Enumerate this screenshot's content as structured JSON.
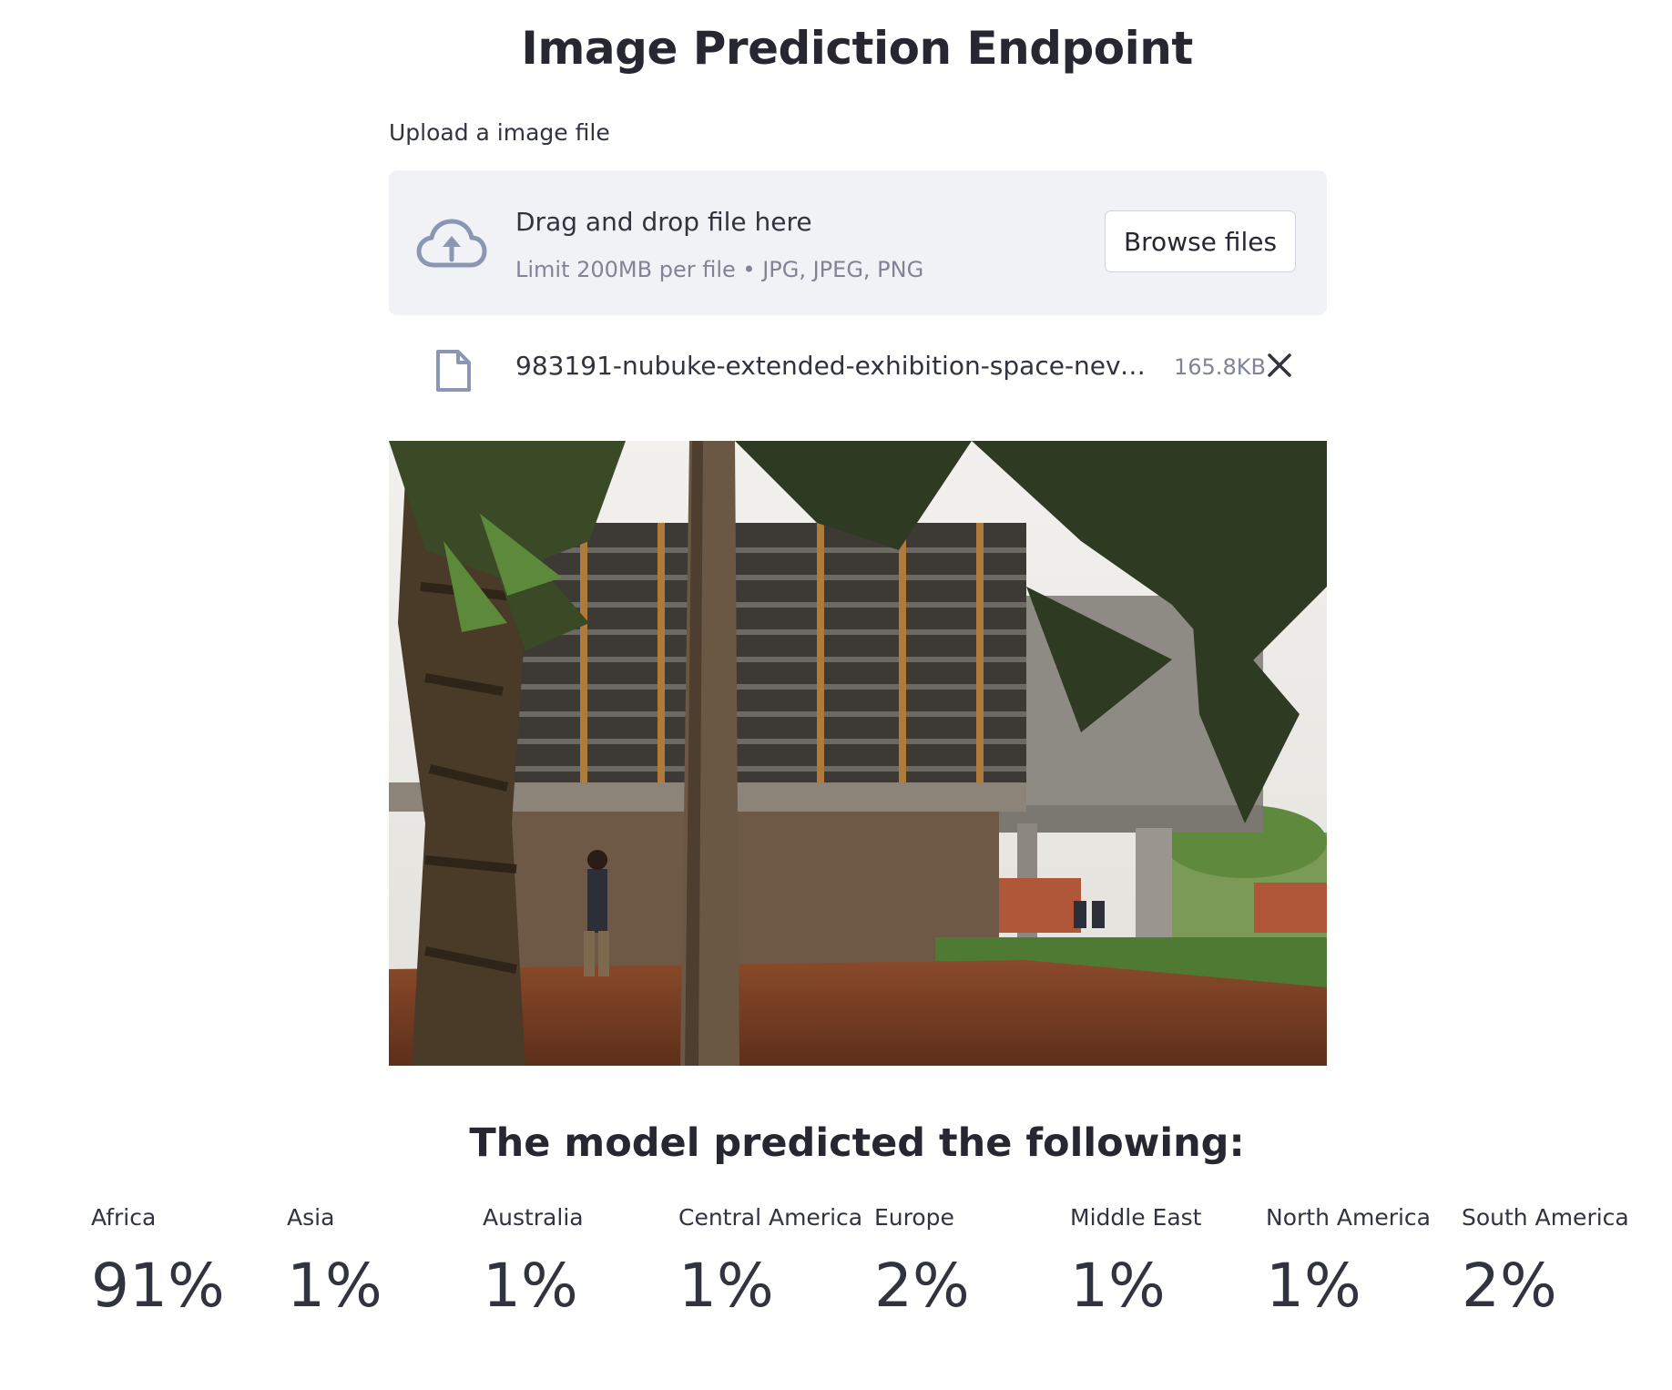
{
  "header": {
    "title": "Image Prediction Endpoint"
  },
  "uploader": {
    "label": "Upload a image file",
    "dropzone_title": "Drag and drop file here",
    "dropzone_limits": "Limit 200MB per file • JPG, JPEG, PNG",
    "browse_label": "Browse files",
    "icon": "cloud-upload-icon"
  },
  "uploaded_file": {
    "name": "983191-nubuke-extended-exhibition-space-nev-s-…",
    "size": "165.8KB",
    "icon": "file-icon",
    "remove_icon": "close-icon"
  },
  "results": {
    "heading": "The model predicted the following:",
    "metrics": [
      {
        "label": "Africa",
        "value": "91%"
      },
      {
        "label": "Asia",
        "value": "1%"
      },
      {
        "label": "Australia",
        "value": "1%"
      },
      {
        "label": "Central America",
        "value": "1%"
      },
      {
        "label": "Europe",
        "value": "2%"
      },
      {
        "label": "Middle East",
        "value": "1%"
      },
      {
        "label": "North America",
        "value": "1%"
      },
      {
        "label": "South America",
        "value": "2%"
      }
    ]
  },
  "colors": {
    "dropzone_bg": "#f0f2f6",
    "text": "#31333f",
    "muted_text": "#808495",
    "icon": "#8a97b3"
  }
}
